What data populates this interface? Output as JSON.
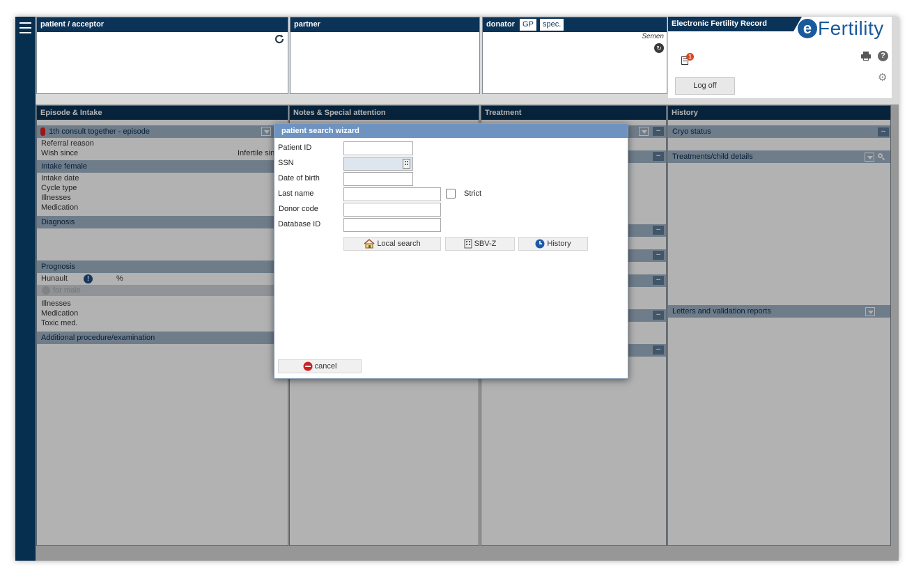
{
  "top_panels": {
    "patient": {
      "title": "patient / acceptor"
    },
    "partner": {
      "title": "partner"
    },
    "donor": {
      "title": "donator",
      "tab_gp": "GP",
      "tab_spec": "spec.",
      "semen_label": "Semen"
    },
    "efr": {
      "title": "Electronic Fertility Record",
      "logo_e": "e",
      "logo_text": "Fertility",
      "logoff": "Log off",
      "badge_count": "1"
    }
  },
  "episode": {
    "title": "Episode & Intake",
    "episode_select": "1th consult together - episode",
    "referral_reason": "Referral reason",
    "wish_since": "Wish since",
    "infertile_since": "Infertile sin",
    "intake_female": "Intake female",
    "intake_date": "Intake date",
    "cycle_type": "Cycle type",
    "illnesses": "Illnesses",
    "medication": "Medication",
    "diagnosis": "Diagnosis",
    "prognosis": "Prognosis",
    "hunault": "Hunault",
    "hunault_unit": "%",
    "male_label": "for male",
    "illnesses2": "Illnesses",
    "medication2": "Medication",
    "toxic_med": "Toxic med.",
    "additional": "Additional procedure/examination"
  },
  "notes": {
    "title": "Notes & Special attention"
  },
  "treatment": {
    "title": "Treatment"
  },
  "history": {
    "title": "History",
    "cryo_status": "Cryo status",
    "treatments_child": "Treatments/child details",
    "letters": "Letters and validation reports",
    "dash": "--"
  },
  "dialog": {
    "title": "patient search wizard",
    "fields": {
      "patient_id": "Patient ID",
      "ssn": "SSN",
      "dob": "Date of birth",
      "last_name": "Last name",
      "strict": "Strict",
      "donor_code": "Donor code",
      "database_id": "Database ID"
    },
    "values": {
      "patient_id": "",
      "ssn": "",
      "dob": "",
      "last_name": "",
      "donor_code": "",
      "database_id": ""
    },
    "buttons": {
      "local_search": "Local search",
      "sbvz": "SBV-Z",
      "history": "History",
      "cancel": "cancel"
    }
  },
  "icons": [
    "menu-icon",
    "refresh-icon",
    "print-icon",
    "help-icon",
    "settings-icon",
    "document-alert-icon",
    "house-icon",
    "building-icon",
    "clock-icon",
    "stop-icon",
    "search-icon"
  ],
  "colors": {
    "header": "#0b3357",
    "sidebar": "#062e4f",
    "section": "#9fb3c8",
    "dialog_header": "#6e93c1",
    "logo": "#1a5a9c"
  }
}
